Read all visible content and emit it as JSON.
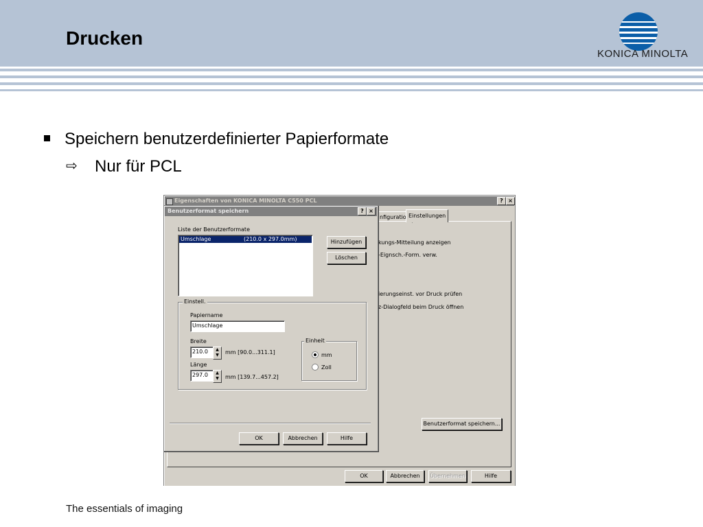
{
  "slide": {
    "title": "Drucken",
    "bullet1": "Speichern benutzerdefinierter Papierformate",
    "bullet2": "Nur für PCL",
    "bullet2_marker": "⇨",
    "footer": "The essentials of imaging",
    "logo_text": "KONICA MINOLTA",
    "brand_color": "#0b5ea8",
    "header_color": "#b5c3d5"
  },
  "bg_window": {
    "title": "Eigenschaften von KONICA MINOLTA C550 PCL",
    "help_btn": "?",
    "close_btn": "×",
    "tabs": [
      "nfiguration",
      "Einstellungen"
    ],
    "lines": [
      "kungs-Mitteilung anzeigen",
      "-Eignsch.-Form. verw.",
      "ierungseinst. vor Druck prüfen",
      "z-Dialogfeld beim Druck öffnen"
    ],
    "save_format_btn": "Benutzerformat speichern...",
    "ok_btn": "OK",
    "cancel_btn": "Abbrechen",
    "apply_btn": "Übernehmen",
    "help_bottom_btn": "Hilfe"
  },
  "dialog": {
    "title": "Benutzerformat speichern",
    "help_btn": "?",
    "close_btn": "×",
    "list_label": "Liste der Benutzerformate",
    "list_items": [
      {
        "name": "Umschlage",
        "size": "(210.0 x 297.0mm)"
      }
    ],
    "add_btn": "Hinzufügen",
    "delete_btn": "Löschen",
    "group_title": "Einstell.",
    "papername_label": "Papiername",
    "papername_value": "Umschlage",
    "width_label": "Breite",
    "width_value": "210.0",
    "width_range": "mm [90.0...311.1]",
    "length_label": "Länge",
    "length_value": "297.0",
    "length_range": "mm [139.7...457.2]",
    "unit_group": "Einheit",
    "unit_mm": "mm",
    "unit_inch": "Zoll",
    "ok_btn": "OK",
    "cancel_btn": "Abbrechen",
    "help_bottom_btn": "Hilfe"
  }
}
